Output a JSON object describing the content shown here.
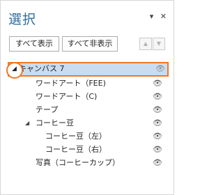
{
  "title": "選択",
  "header_icons": {
    "dropdown": "▾",
    "close": "✕"
  },
  "buttons": {
    "show_all": "すべて表示",
    "hide_all": "すべて非表示"
  },
  "order_buttons": {
    "up": "▲",
    "down": "▼"
  },
  "list": {
    "eye_glyph": "👁",
    "expand_glyph": "◢",
    "items": [
      {
        "label": "キャンバス 7",
        "selected": true,
        "indent": 1,
        "group": true
      },
      {
        "label": "ワードアート（FEE)",
        "indent": 2
      },
      {
        "label": "ワードアート（C)",
        "indent": 2
      },
      {
        "label": "テープ",
        "indent": 2
      },
      {
        "label": "コーヒー豆",
        "indent": 2,
        "group": true
      },
      {
        "label": "コーヒー豆（左）",
        "indent": 3
      },
      {
        "label": "コーヒー豆（右）",
        "indent": 3
      },
      {
        "label": "写真（コーヒーカップ）",
        "indent": 2
      }
    ]
  }
}
